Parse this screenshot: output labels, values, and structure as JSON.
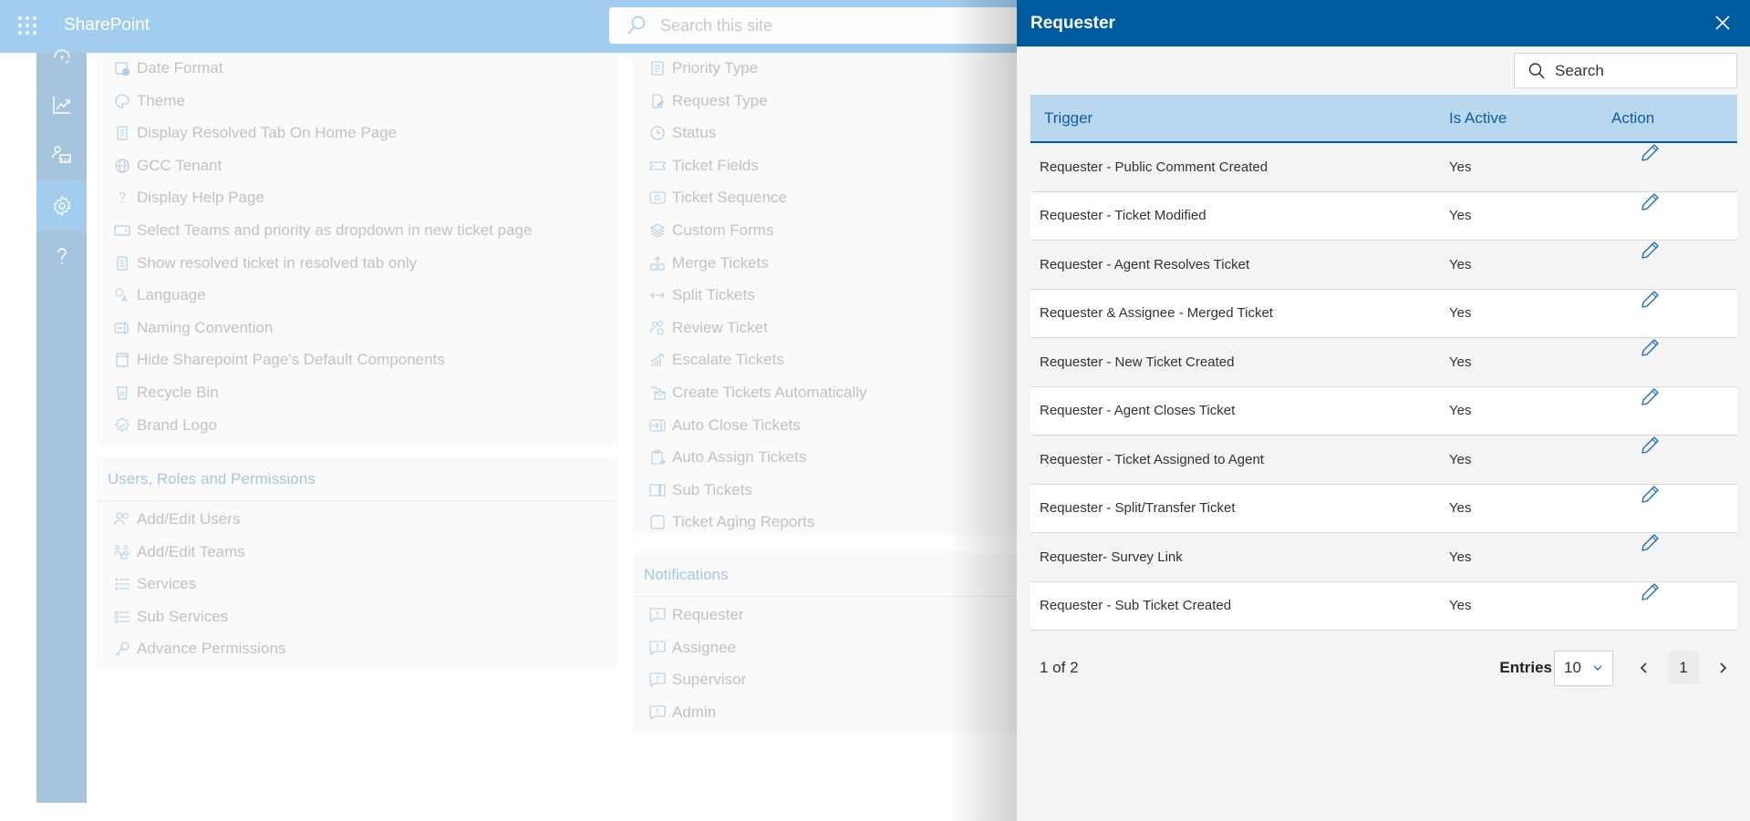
{
  "topbar": {
    "app_name": "SharePoint",
    "search_placeholder": "Search this site"
  },
  "rail": {
    "items": [
      {
        "name": "dashboard",
        "icon": "gauge-icon"
      },
      {
        "name": "reports",
        "icon": "chart-line-icon"
      },
      {
        "name": "users-teams",
        "icon": "people-team-icon"
      },
      {
        "name": "settings",
        "icon": "gear-icon",
        "active": true
      },
      {
        "name": "help",
        "icon": "question-icon"
      }
    ]
  },
  "settings_left": {
    "general_items": [
      {
        "label": "Date Format",
        "icon": "calendar-clock-icon"
      },
      {
        "label": "Theme",
        "icon": "palette-icon"
      },
      {
        "label": "Display Resolved Tab On Home Page",
        "icon": "document-icon"
      },
      {
        "label": "GCC Tenant",
        "icon": "globe-icon"
      },
      {
        "label": "Display Help Page",
        "icon": "question-icon"
      },
      {
        "label": "Select Teams and priority as dropdown in new ticket page",
        "icon": "dropdown-box-icon"
      },
      {
        "label": "Show resolved ticket in resolved tab only",
        "icon": "document-icon"
      },
      {
        "label": "Language",
        "icon": "translate-icon"
      },
      {
        "label": "Naming Convention",
        "icon": "rename-icon"
      },
      {
        "label": "Hide Sharepoint Page's Default Components",
        "icon": "window-header-icon"
      },
      {
        "label": "Recycle Bin",
        "icon": "recycle-bin-icon"
      },
      {
        "label": "Brand Logo",
        "icon": "badge-check-icon"
      }
    ],
    "users_section_title": "Users, Roles and Permissions",
    "users_items": [
      {
        "label": "Add/Edit Users",
        "icon": "people-icon"
      },
      {
        "label": "Add/Edit Teams",
        "icon": "people-team-icon"
      },
      {
        "label": "Services",
        "icon": "list-icon"
      },
      {
        "label": "Sub Services",
        "icon": "sub-list-icon"
      },
      {
        "label": "Advance Permissions",
        "icon": "key-icon"
      }
    ]
  },
  "settings_right": {
    "ticket_items": [
      {
        "label": "Priority Type",
        "icon": "task-list-icon"
      },
      {
        "label": "Request Type",
        "icon": "document-edit-icon"
      },
      {
        "label": "Status",
        "icon": "clock-icon"
      },
      {
        "label": "Ticket Fields",
        "icon": "ticket-icon"
      },
      {
        "label": "Ticket Sequence",
        "icon": "sequence-icon"
      },
      {
        "label": "Custom Forms",
        "icon": "layers-icon"
      },
      {
        "label": "Merge Tickets",
        "icon": "merge-icon"
      },
      {
        "label": "Split Tickets",
        "icon": "split-arrows-icon"
      },
      {
        "label": "Review Ticket",
        "icon": "people-sync-icon"
      },
      {
        "label": "Escalate Tickets",
        "icon": "chart-arrow-up-icon"
      },
      {
        "label": "Create Tickets Automatically",
        "icon": "mail-folder-icon"
      },
      {
        "label": "Auto Close Tickets",
        "icon": "arrow-in-box-icon"
      },
      {
        "label": "Auto Assign Tickets",
        "icon": "clipboard-arrow-icon"
      },
      {
        "label": "Sub Tickets",
        "icon": "split-box-icon"
      },
      {
        "label": "Ticket Aging Reports",
        "icon": "square-icon"
      }
    ],
    "notifications_title": "Notifications",
    "notification_items": [
      {
        "label": "Requester",
        "icon": "comment-alert-icon"
      },
      {
        "label": "Assignee",
        "icon": "comment-alert-icon"
      },
      {
        "label": "Supervisor",
        "icon": "comment-alert-icon"
      },
      {
        "label": "Admin",
        "icon": "comment-alert-icon"
      }
    ]
  },
  "flyout": {
    "title": "Requester",
    "search_placeholder": "Search",
    "columns": {
      "trigger": "Trigger",
      "is_active": "Is Active",
      "action": "Action"
    },
    "rows": [
      {
        "trigger": "Requester - Public Comment Created",
        "is_active": "Yes"
      },
      {
        "trigger": "Requester - Ticket Modified",
        "is_active": "Yes"
      },
      {
        "trigger": "Requester - Agent Resolves Ticket",
        "is_active": "Yes"
      },
      {
        "trigger": "Requester & Assignee - Merged Ticket",
        "is_active": "Yes"
      },
      {
        "trigger": "Requester - New Ticket Created",
        "is_active": "Yes"
      },
      {
        "trigger": "Requester - Agent Closes Ticket",
        "is_active": "Yes"
      },
      {
        "trigger": "Requester - Ticket Assigned to Agent",
        "is_active": "Yes"
      },
      {
        "trigger": "Requester - Split/Transfer Ticket",
        "is_active": "Yes"
      },
      {
        "trigger": "Requester- Survey Link",
        "is_active": "Yes"
      },
      {
        "trigger": "Requester - Sub Ticket Created",
        "is_active": "Yes"
      }
    ],
    "footer": {
      "page_info": "1 of 2",
      "entries_label": "Entries",
      "entries_value": "10",
      "current_page": "1"
    }
  },
  "colors": {
    "topbar": "#a3cdef",
    "rail": "#a6c4de",
    "flyout_header": "#005a9e",
    "table_header": "#b9d7ef",
    "accent": "#0f5da0"
  }
}
